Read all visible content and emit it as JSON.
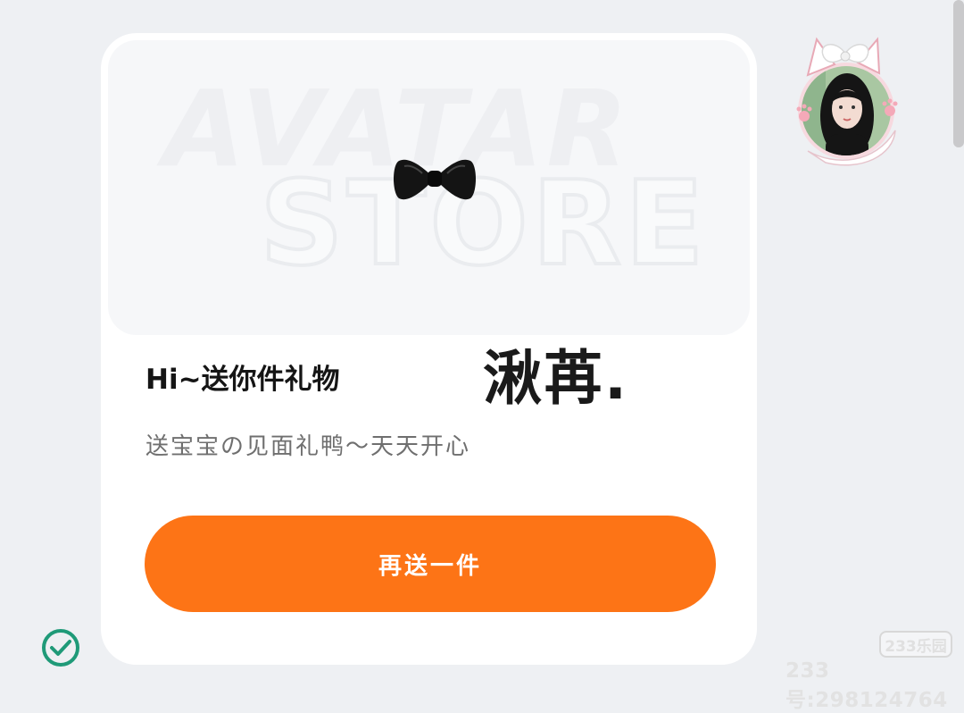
{
  "banner": {
    "watermark_line1": "AVATAR",
    "watermark_line2": "STORE",
    "item_icon": "black-bow-tie-icon"
  },
  "gift": {
    "greeting": "Hi~送你件礼物",
    "username": "湫苒.",
    "message": "送宝宝の见面礼鸭～天天开心",
    "send_again_label": "再送一件"
  },
  "watermark": {
    "logo_text": "233乐园",
    "account_text": "233号:298124764"
  },
  "colors": {
    "accent": "#fd7416",
    "check": "#1f9a78"
  }
}
